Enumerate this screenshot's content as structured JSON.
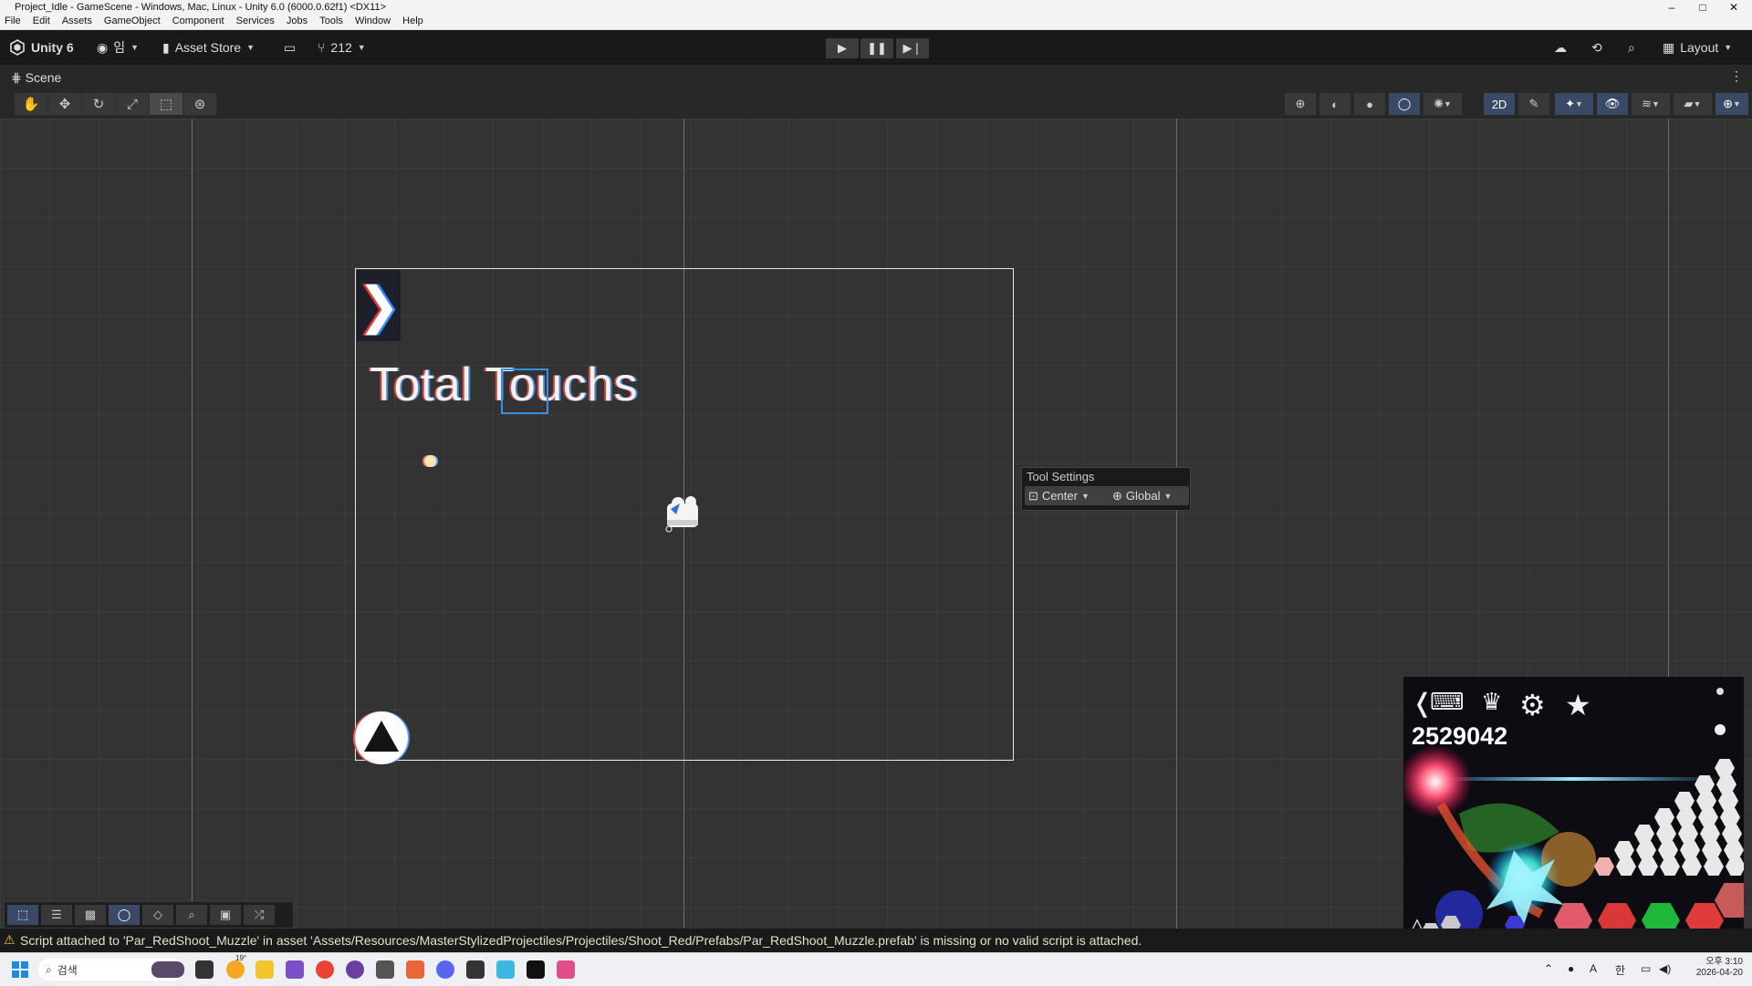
{
  "window": {
    "title": "Project_Idle - GameScene - Windows, Mac, Linux - Unity 6.0 (6000.0.62f1) <DX11>",
    "controls": [
      "–",
      "□",
      "✕"
    ]
  },
  "menu": [
    "File",
    "Edit",
    "Assets",
    "GameObject",
    "Component",
    "Services",
    "Jobs",
    "Tools",
    "Window",
    "Help"
  ],
  "toolbar": {
    "unity_label": "Unity 6",
    "account_label": "임",
    "asset_store_label": "Asset Store",
    "version_count": "212",
    "layout_label": "Layout"
  },
  "scene_tab": {
    "label": "Scene"
  },
  "scene_toolbar": {
    "mode_2d": "2D"
  },
  "viewport": {
    "title_text": "Total Touchs",
    "tool_settings": {
      "header": "Tool Settings",
      "pivot_label": "Center",
      "space_label": "Global"
    }
  },
  "game_preview": {
    "score": "2529042"
  },
  "status": {
    "message": "Script attached to 'Par_RedShoot_Muzzle' in asset 'Assets/Resources/MasterStylizedProjectiles/Projectiles/Shoot_Red/Prefabs/Par_RedShoot_Muzzle.prefab' is missing or no valid script is attached."
  },
  "taskbar": {
    "search_placeholder": "검색",
    "weather": "19°",
    "time": "오후 3:10",
    "date": "2026-04-20"
  },
  "colors": {
    "accent": "#3b8fe0",
    "warning": "#f5c02a",
    "toolbar_bg": "#191919",
    "viewport_bg": "#333333"
  }
}
